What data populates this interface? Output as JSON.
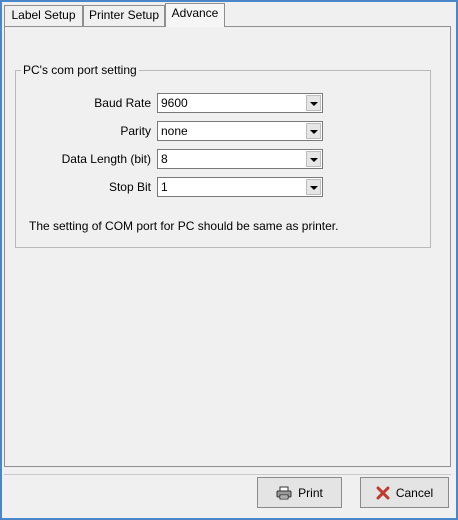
{
  "tabs": [
    {
      "label": "Label Setup"
    },
    {
      "label": "Printer Setup"
    },
    {
      "label": "Advance"
    }
  ],
  "group": {
    "title": "PC's com port setting",
    "fields": [
      {
        "label": "Baud Rate",
        "value": "9600"
      },
      {
        "label": "Parity",
        "value": "none"
      },
      {
        "label": "Data Length (bit)",
        "value": "8"
      },
      {
        "label": "Stop Bit",
        "value": "1"
      }
    ],
    "note": "The setting of COM port for PC should be same as printer."
  },
  "buttons": {
    "print": "Print",
    "cancel": "Cancel"
  },
  "icons": {
    "print": "printer-icon",
    "cancel": "x-icon"
  },
  "colors": {
    "frame": "#4a86c8",
    "cancel_x": "#c0392b"
  }
}
